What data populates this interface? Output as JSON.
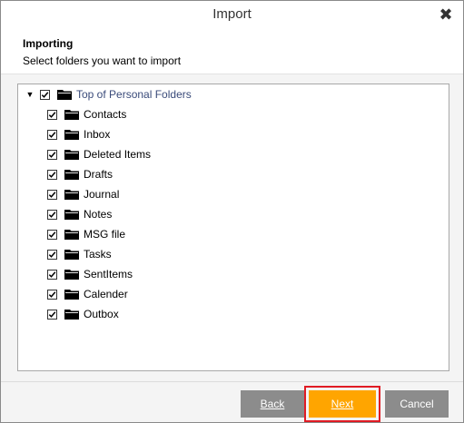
{
  "window": {
    "title": "Import",
    "close_glyph": "✖"
  },
  "header": {
    "title": "Importing",
    "subtitle": "Select folders you want to import"
  },
  "tree": {
    "root": {
      "label": "Top of Personal Folders",
      "checked": true,
      "expanded": true,
      "expander_glyph": "▼",
      "icon": "folder-icon"
    },
    "children": [
      {
        "label": "Contacts",
        "checked": true,
        "icon": "folder-icon"
      },
      {
        "label": "Inbox",
        "checked": true,
        "icon": "folder-icon"
      },
      {
        "label": "Deleted Items",
        "checked": true,
        "icon": "folder-icon"
      },
      {
        "label": "Drafts",
        "checked": true,
        "icon": "folder-icon"
      },
      {
        "label": "Journal",
        "checked": true,
        "icon": "folder-icon"
      },
      {
        "label": "Notes",
        "checked": true,
        "icon": "folder-icon"
      },
      {
        "label": "MSG file",
        "checked": true,
        "icon": "folder-icon"
      },
      {
        "label": "Tasks",
        "checked": true,
        "icon": "folder-icon"
      },
      {
        "label": "SentItems",
        "checked": true,
        "icon": "folder-icon"
      },
      {
        "label": "Calender",
        "checked": true,
        "icon": "folder-icon"
      },
      {
        "label": "Outbox",
        "checked": true,
        "icon": "folder-icon"
      }
    ]
  },
  "footer": {
    "back_label": "Back",
    "next_label": "Next",
    "cancel_label": "Cancel"
  },
  "colors": {
    "next_button": "#ffa500",
    "next_highlight": "#e01b24",
    "secondary_button": "#8c8c8c"
  }
}
